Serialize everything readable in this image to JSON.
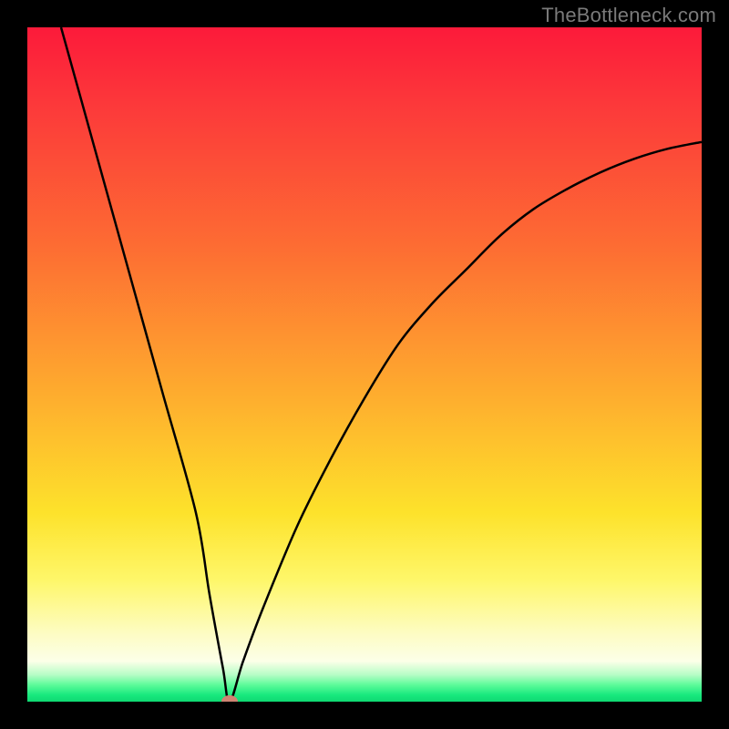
{
  "watermark": "TheBottleneck.com",
  "marker_color": "#cf8472",
  "curve_stroke": "#000000",
  "chart_data": {
    "type": "line",
    "title": "",
    "xlabel": "",
    "ylabel": "",
    "xlim": [
      0,
      100
    ],
    "ylim": [
      0,
      100
    ],
    "series": [
      {
        "name": "bottleneck-curve",
        "x": [
          5,
          10,
          15,
          20,
          25,
          27,
          29,
          30,
          32,
          35,
          40,
          45,
          50,
          55,
          60,
          65,
          70,
          75,
          80,
          85,
          90,
          95,
          100
        ],
        "values": [
          100,
          82,
          64,
          46,
          28,
          16,
          5,
          0,
          6,
          14,
          26,
          36,
          45,
          53,
          59,
          64,
          69,
          73,
          76,
          78.5,
          80.5,
          82,
          83
        ]
      }
    ],
    "marker": {
      "x": 30,
      "y": 0,
      "color": "#cf8472"
    },
    "grid": false,
    "legend": false
  }
}
